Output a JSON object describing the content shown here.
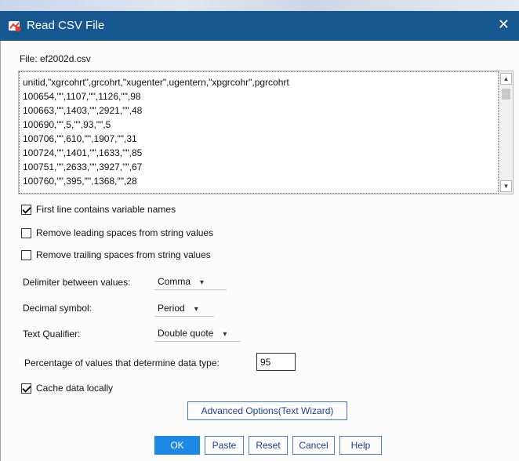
{
  "window": {
    "title": "Read CSV File",
    "close_glyph": "✕",
    "app_icon": "spss-icon"
  },
  "file": {
    "label": "File: ef2002d.csv"
  },
  "preview": {
    "lines": [
      "unitid,\"xgrcohrt\",grcohrt,\"xugenter\",ugentern,\"xpgrcohr\",pgrcohrt",
      "100654,\"\",1107,\"\",1126,\"\",98",
      "100663,\"\",1403,\"\",2921,\"\",48",
      "100690,\"\",5,\"\",93,\"\",5",
      "100706,\"\",610,\"\",1907,\"\",31",
      "100724,\"\",1401,\"\",1633,\"\",85",
      "100751,\"\",2633,\"\",3927,\"\",67",
      "100760,\"\",395,\"\",1368,\"\",28"
    ]
  },
  "options": {
    "first_line_names": {
      "label": "First line contains variable names",
      "checked": true
    },
    "remove_leading": {
      "label": "Remove leading spaces from string values",
      "checked": false
    },
    "remove_trailing": {
      "label": "Remove trailing spaces from string values",
      "checked": false
    },
    "cache_data": {
      "label": "Cache data locally",
      "checked": true
    }
  },
  "delimiter": {
    "label": "Delimiter between values:",
    "value": "Comma"
  },
  "decimal": {
    "label": "Decimal symbol:",
    "value": "Period"
  },
  "qualifier": {
    "label": "Text Qualifier:",
    "value": "Double quote"
  },
  "percentage": {
    "label": "Percentage of values that determine data type:",
    "value": "95"
  },
  "buttons": {
    "advanced": "Advanced Options(Text Wizard)",
    "ok": "OK",
    "paste": "Paste",
    "reset": "Reset",
    "cancel": "Cancel",
    "help": "Help"
  },
  "colors": {
    "titlebar": "#17578f",
    "primary_button": "#1e88e5",
    "button_text": "#1f3f93"
  }
}
